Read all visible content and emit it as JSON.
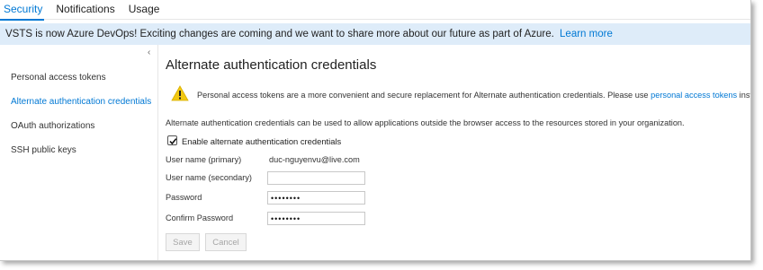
{
  "tabs": [
    {
      "label": "Security",
      "active": true
    },
    {
      "label": "Notifications",
      "active": false
    },
    {
      "label": "Usage",
      "active": false
    }
  ],
  "banner": {
    "text": "VSTS is now Azure DevOps! Exciting changes are coming and we want to share more about our future as part of Azure.",
    "link": "Learn more"
  },
  "sidebar": {
    "collapse_glyph": "‹",
    "items": [
      {
        "label": "Personal access tokens",
        "active": false
      },
      {
        "label": "Alternate authentication credentials",
        "active": true
      },
      {
        "label": "OAuth authorizations",
        "active": false
      },
      {
        "label": "SSH public keys",
        "active": false
      }
    ]
  },
  "main": {
    "title": "Alternate authentication credentials",
    "warning": {
      "icon": "warning-icon",
      "text_before": "Personal access tokens are a more convenient and secure replacement for Alternate authentication credentials. Please use",
      "link": "personal access tokens",
      "text_after": "instead."
    },
    "description": "Alternate authentication credentials can be used to allow applications outside the browser access to the resources stored in your organization.",
    "checkbox": {
      "label": "Enable alternate authentication credentials",
      "checked": true
    },
    "fields": {
      "primary_label": "User name (primary)",
      "primary_value": "duc-nguyenvu@live.com",
      "secondary_label": "User name (secondary)",
      "secondary_value": "",
      "password_label": "Password",
      "password_value": "••••••••",
      "confirm_label": "Confirm Password",
      "confirm_value": "••••••••"
    },
    "buttons": {
      "save": "Save",
      "cancel": "Cancel"
    }
  },
  "colors": {
    "accent": "#0078d4",
    "banner_bg": "#deecf9",
    "warning": "#f2c811"
  }
}
